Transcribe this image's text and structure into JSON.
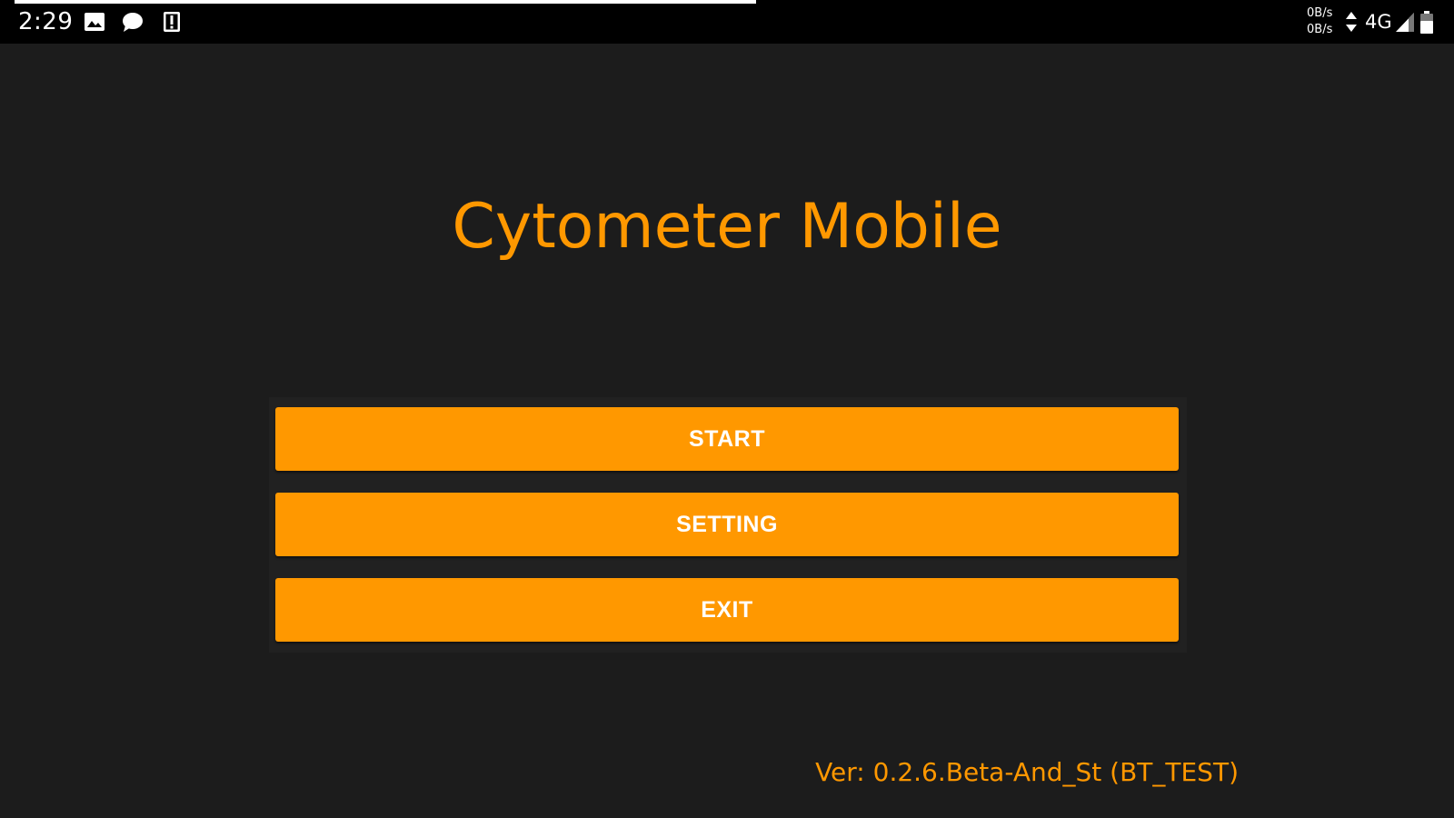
{
  "status_bar": {
    "time": "2:29",
    "icons": [
      "image-icon",
      "message-icon",
      "alert-icon"
    ],
    "net_speed_up": "0B/s",
    "net_speed_down": "0B/s",
    "network_type": "4G",
    "right_icons": [
      "data-arrows-icon",
      "signal-icon",
      "battery-icon"
    ]
  },
  "app": {
    "title": "Cytometer Mobile",
    "accent_color": "#ff9800",
    "background_color": "#1c1c1c"
  },
  "menu": {
    "start_label": "START",
    "setting_label": "SETTING",
    "exit_label": "EXIT"
  },
  "footer": {
    "version": "Ver: 0.2.6.Beta-And_St (BT_TEST)"
  }
}
